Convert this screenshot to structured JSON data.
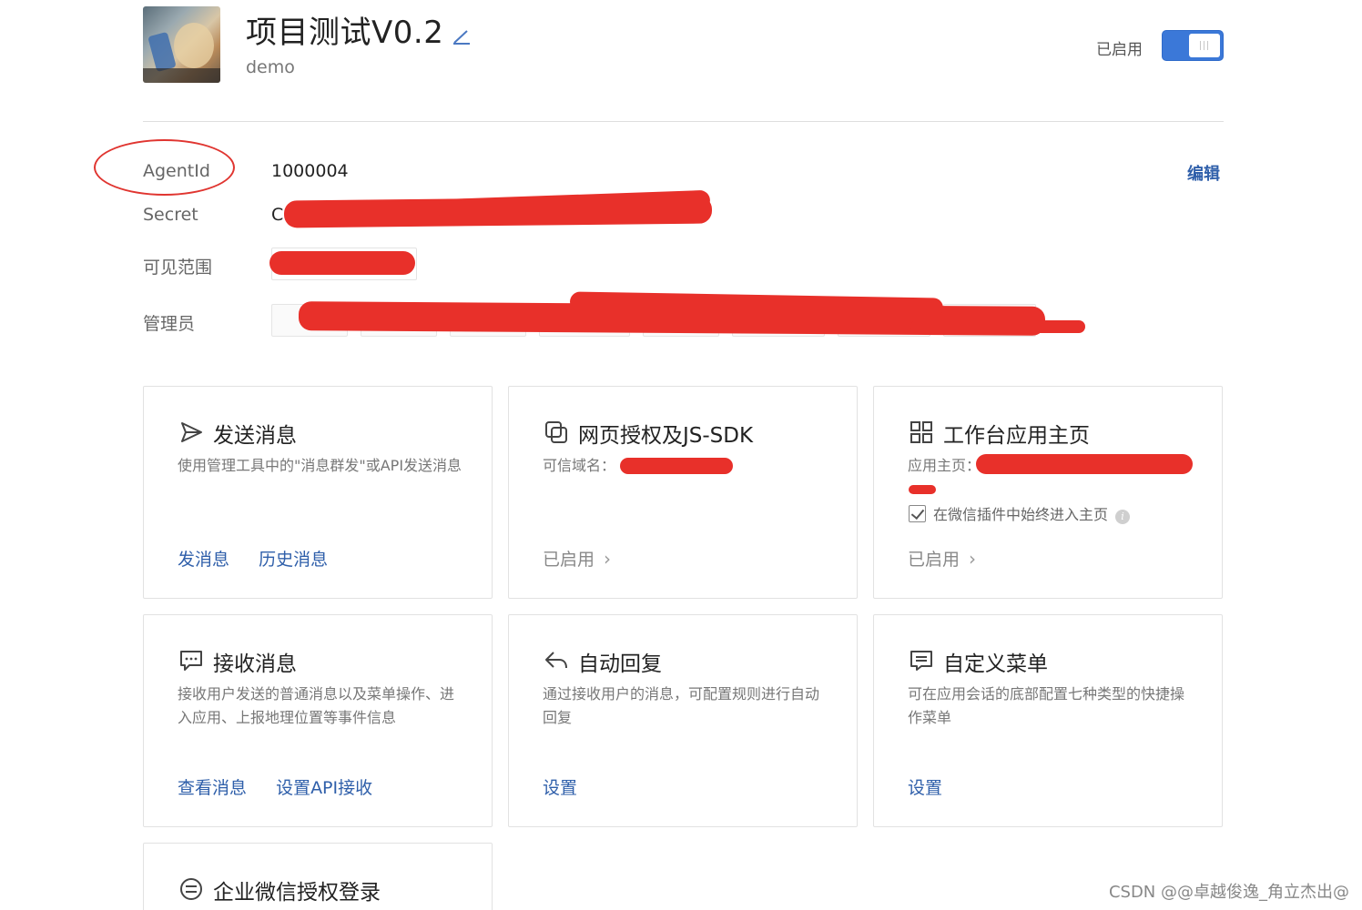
{
  "header": {
    "title": "项目测试V0.2",
    "subtitle": "demo",
    "status_label": "已启用",
    "toggle_on": true
  },
  "info": {
    "agentid_label": "AgentId",
    "agentid_value": "1000004",
    "secret_label": "Secret",
    "secret_value_prefix": "C",
    "scope_label": "可见范围",
    "admin_label": "管理员",
    "edit_label": "编辑"
  },
  "cards": [
    {
      "icon": "send-icon",
      "title": "发送消息",
      "desc": "使用管理工具中的\"消息群发\"或API发送消息",
      "actions": [
        "发消息",
        "历史消息"
      ]
    },
    {
      "icon": "webpage-auth-icon",
      "title": "网页授权及JS-SDK",
      "desc_label": "可信域名：",
      "status": "已启用"
    },
    {
      "icon": "grid-apps-icon",
      "title": "工作台应用主页",
      "desc_label": "应用主页：",
      "checkbox_label": "在微信插件中始终进入主页",
      "checkbox_checked": true,
      "status": "已启用"
    },
    {
      "icon": "chat-bubble-icon",
      "title": "接收消息",
      "desc": "接收用户发送的普通消息以及菜单操作、进入应用、上报地理位置等事件信息",
      "actions": [
        "查看消息",
        "设置API接收"
      ]
    },
    {
      "icon": "reply-icon",
      "title": "自动回复",
      "desc": "通过接收用户的消息，可配置规则进行自动回复",
      "actions": [
        "设置"
      ]
    },
    {
      "icon": "menu-icon",
      "title": "自定义菜单",
      "desc": "可在应用会话的底部配置七种类型的快捷操作菜单",
      "actions": [
        "设置"
      ]
    },
    {
      "icon": "wecom-login-icon",
      "title": "企业微信授权登录"
    }
  ],
  "watermark": "CSDN @@卓越俊逸_角立杰出@",
  "colors": {
    "accent": "#3b78d8",
    "link": "#2f5faa",
    "redaction": "#e8302a"
  }
}
